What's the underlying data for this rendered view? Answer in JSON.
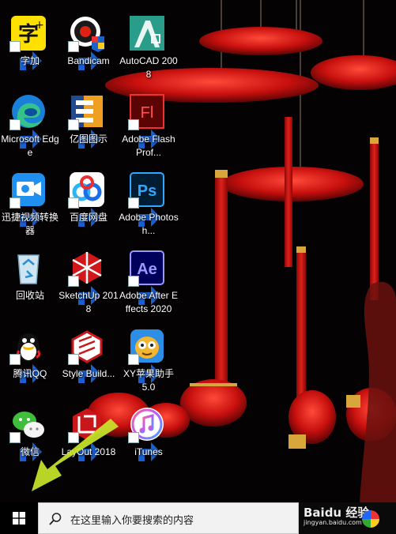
{
  "desktop": {
    "icons": [
      {
        "label": "字加",
        "icon": "zijia-icon"
      },
      {
        "label": "Bandicam",
        "icon": "bandicam-icon"
      },
      {
        "label": "AutoCAD 2008",
        "icon": "autocad-icon"
      },
      {
        "label": "Microsoft Edge",
        "icon": "edge-icon"
      },
      {
        "label": "亿图图示",
        "icon": "edraw-icon"
      },
      {
        "label": "Adobe Flash Prof...",
        "icon": "flash-icon"
      },
      {
        "label": "迅捷视频转换器",
        "icon": "video-converter-icon"
      },
      {
        "label": "百度网盘",
        "icon": "baidu-netdisk-icon"
      },
      {
        "label": "Adobe Photosh...",
        "icon": "photoshop-icon"
      },
      {
        "label": "回收站",
        "icon": "recycle-bin-icon"
      },
      {
        "label": "SketchUp 2018",
        "icon": "sketchup-icon"
      },
      {
        "label": "Adobe After Effects 2020",
        "icon": "after-effects-icon"
      },
      {
        "label": "腾讯QQ",
        "icon": "qq-icon"
      },
      {
        "label": "Style Build...",
        "icon": "style-builder-icon"
      },
      {
        "label": "XY苹果助手 5.0",
        "icon": "xy-assistant-icon"
      },
      {
        "label": "微信",
        "icon": "wechat-icon"
      },
      {
        "label": "LayOut 2018",
        "icon": "layout-icon"
      },
      {
        "label": "iTunes",
        "icon": "itunes-icon"
      }
    ]
  },
  "taskbar": {
    "search_placeholder": "在这里输入你要搜索的内容",
    "watermark_main": "Baidu 经验",
    "watermark_sub": "jingyan.baidu.com"
  },
  "colors": {
    "wallpaper": "#050203",
    "lantern_red": "#d11515",
    "gold": "#d8a63a",
    "arrow": "#c8e62a",
    "taskbar": "#000000"
  }
}
